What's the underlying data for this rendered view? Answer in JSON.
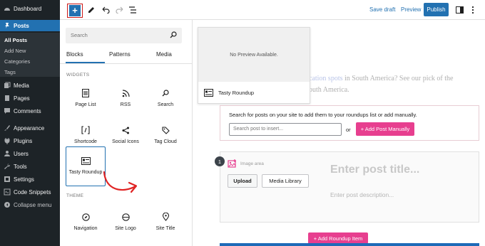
{
  "admin_menu": {
    "dashboard": "Dashboard",
    "posts": "Posts",
    "posts_sub": [
      "All Posts",
      "Add New",
      "Categories",
      "Tags"
    ],
    "media": "Media",
    "pages": "Pages",
    "comments": "Comments",
    "appearance": "Appearance",
    "plugins": "Plugins",
    "users": "Users",
    "tools": "Tools",
    "settings": "Settings",
    "code_snippets": "Code Snippets",
    "collapse": "Collapse menu"
  },
  "toolbar": {
    "save_draft": "Save draft",
    "preview": "Preview",
    "publish": "Publish"
  },
  "inserter": {
    "search_placeholder": "Search",
    "tabs": [
      "Blocks",
      "Patterns",
      "Media"
    ],
    "widgets_heading": "WIDGETS",
    "widgets": [
      "Page List",
      "RSS",
      "Search",
      "Shortcode",
      "Social Icons",
      "Tag Cloud",
      "Tasty Roundup"
    ],
    "theme_heading": "THEME",
    "theme_blocks": [
      "Navigation",
      "Site Logo",
      "Site Title"
    ]
  },
  "canvas": {
    "bg_text_1_link": "cation spots",
    "bg_text_1_rest": " in South America? See our pick of the",
    "bg_text_2": "outh America.",
    "preview_empty": "No Preview Available.",
    "preview_block_name": "Tasty Roundup",
    "search_help": "Search for posts on your site to add them to your roundups list or add manually.",
    "search_placeholder": "Search post to insert...",
    "or_label": "or",
    "add_post_manually": "+ Add Post Manually",
    "item_number": "1",
    "image_area": "Image area",
    "upload": "Upload",
    "media_library": "Media Library",
    "title_placeholder": "Enter post title...",
    "description_placeholder": "Enter post description...",
    "add_roundup_item": "+ Add Roundup Item"
  },
  "colors": {
    "admin_bg": "#1d2327",
    "accent": "#2271b1",
    "pink": "#e73f8f",
    "highlight_red": "#cc1818"
  }
}
